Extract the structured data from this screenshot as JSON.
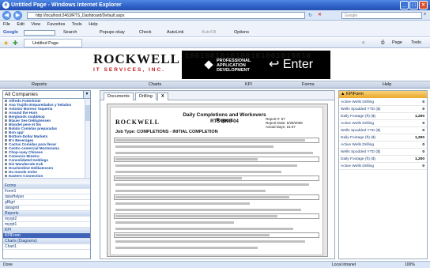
{
  "window": {
    "title": "Untitled Page - Windows Internet Explorer"
  },
  "address": {
    "url": "http://localhost:2463/RTS_Dashboard/Default.aspx",
    "search_placeholder": "Google"
  },
  "menu": {
    "items": [
      "File",
      "Edit",
      "View",
      "Favorites",
      "Tools",
      "Help"
    ]
  },
  "googlebar": {
    "label": "Google",
    "search_label": "Search",
    "popups_label": "Popups okay",
    "check_label": "Check",
    "autolink_label": "AutoLink",
    "autofill_label": "AutoFill",
    "options_label": "Options"
  },
  "favbar": {
    "tab_label": "Untitled Page",
    "page_label": "Page",
    "tools_label": "Tools"
  },
  "header": {
    "logo_main": "ROCKWELL",
    "logo_sub": "IT SERVICES, INC.",
    "banner_bits": "1001001010100101001010010",
    "banner_line1": "PROFESSIONAL",
    "banner_line2": "APPLICATION",
    "banner_line3": "DEVELOPMENT",
    "enter_label": "Enter"
  },
  "nav": {
    "items": [
      "Reports",
      "Charts",
      "KPI",
      "Forms",
      "Help"
    ]
  },
  "left": {
    "dropdown_value": "All Companies",
    "companies": [
      "Alfreds Futterkiste",
      "Ana Trujillo Emparedados y helados",
      "Antonio Moreno Taqueria",
      "Around the Horn",
      "Berglunds snabbkop",
      "Blauer See Delikatessen",
      "Blondel pere et fils",
      "Bolido Comidas preparadas",
      "Bon app'",
      "Bottom-Dollar Markets",
      "B's Beverages",
      "Cactus Comidas para llevar",
      "Centro comercial Moctezuma",
      "Chop-suey Chinese",
      "Comercio Mineiro",
      "Consolidated Holdings",
      "Die Wandernde Kuh",
      "Drachenblut Delikatessen",
      "Du monde entier",
      "Eastern Connection",
      "Ernst Handel",
      "Familia Arquibaldo",
      "Folies gourmandes",
      "Folk och fa HB",
      "France restauration"
    ],
    "sections": [
      {
        "label": "Forms",
        "kind": "head"
      },
      {
        "label": "Form1",
        "kind": "item"
      },
      {
        "label": "dataHelper",
        "kind": "item"
      },
      {
        "label": "gBlgrl",
        "kind": "item"
      },
      {
        "label": "datagrid",
        "kind": "item"
      },
      {
        "label": "Reports",
        "kind": "head"
      },
      {
        "label": "myrpt2",
        "kind": "item"
      },
      {
        "label": "myrpt1",
        "kind": "item"
      },
      {
        "label": "KPI",
        "kind": "head"
      },
      {
        "label": "KPIFrom",
        "kind": "sel"
      },
      {
        "label": "Charts (Diagrams)",
        "kind": "head"
      },
      {
        "label": "Chart1",
        "kind": "item"
      }
    ]
  },
  "doc": {
    "tabs": [
      "Documents",
      "Drilling"
    ],
    "close_label": "X",
    "report_title": "Daily Completions and Workovers Report",
    "report_sub": "RTS 2003-04",
    "report_meta1": "Report #: 57",
    "report_meta2": "Report Date: 5/28/2008",
    "report_meta3": "Actual Days: 15.07",
    "job_type": "Job Type: COMPLETIONS - INITIAL COMPLETION"
  },
  "kpi": {
    "title": "KPIForm",
    "rows": [
      {
        "label": "Active Wells Drilling",
        "value": "0"
      },
      {
        "label": "Wells Spudded YTD ($)",
        "value": "0"
      },
      {
        "label": "Daily Footage (ft) ($)",
        "value": "1,200"
      },
      {
        "label": "Active Wells Drilling",
        "value": "0"
      },
      {
        "label": "Wells Spudded YTD ($)",
        "value": "0"
      },
      {
        "label": "Daily Footage (ft) ($)",
        "value": "1,200"
      },
      {
        "label": "Active Wells Drilling",
        "value": "0"
      },
      {
        "label": "Wells Spudded YTD ($)",
        "value": "0"
      },
      {
        "label": "Daily Footage (ft) ($)",
        "value": "1,200"
      },
      {
        "label": "Active Wells Drilling",
        "value": "0"
      }
    ]
  },
  "status": {
    "left": "Done",
    "zone": "Local intranet",
    "zoom": "100%"
  },
  "colors": {
    "titlebar": "#2f62c8",
    "accent_red": "#c4161c",
    "kpi_header": "#eaaa2a"
  }
}
